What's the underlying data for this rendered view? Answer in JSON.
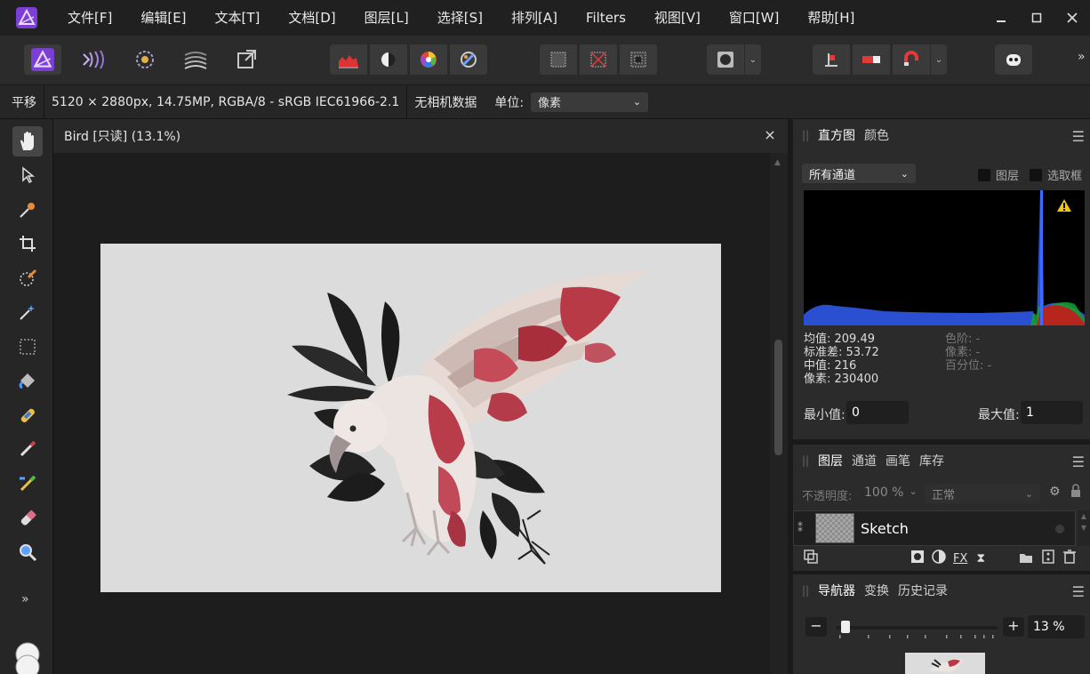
{
  "menu": [
    "文件[F]",
    "编辑[E]",
    "文本[T]",
    "文档[D]",
    "图层[L]",
    "选择[S]",
    "排列[A]",
    "Filters",
    "视图[V]",
    "窗口[W]",
    "帮助[H]"
  ],
  "toolbar": {
    "overflow": "»"
  },
  "context": {
    "tool": "平移",
    "info": "5120 × 2880px, 14.75MP, RGBA/8 - sRGB IEC61966-2.1",
    "camera": "无相机数据",
    "units_label": "单位:",
    "units_value": "像素"
  },
  "tools": {
    "more": "»"
  },
  "document": {
    "title": "Bird [只读] (13.1%)",
    "close": "×"
  },
  "histogram_panel": {
    "tabs": [
      "直方图",
      "颜色"
    ],
    "channel": "所有通道",
    "check_layer": "图层",
    "check_marquee": "选取框",
    "stats": [
      "均值: 209.49",
      "标准差: 53.72",
      "中值: 216",
      "像素: 230400"
    ],
    "stats_dim": [
      "色阶: -",
      "像素: -",
      "百分位: -"
    ],
    "min_label": "最小值:",
    "min_value": "0",
    "max_label": "最大值:",
    "max_value": "1"
  },
  "layers_panel": {
    "tabs": [
      "图层",
      "通道",
      "画笔",
      "库存"
    ],
    "opacity_label": "不透明度:",
    "opacity_value": "100 %",
    "blend_mode": "正常",
    "layer_name": "Sketch"
  },
  "navigator_panel": {
    "tabs": [
      "导航器",
      "变换",
      "历史记录"
    ],
    "zoom_value": "13 %",
    "zoom_level": 0.13
  },
  "colors": {
    "accent": "#7b3fd6",
    "histogram_blue": "#2a4fd0"
  }
}
